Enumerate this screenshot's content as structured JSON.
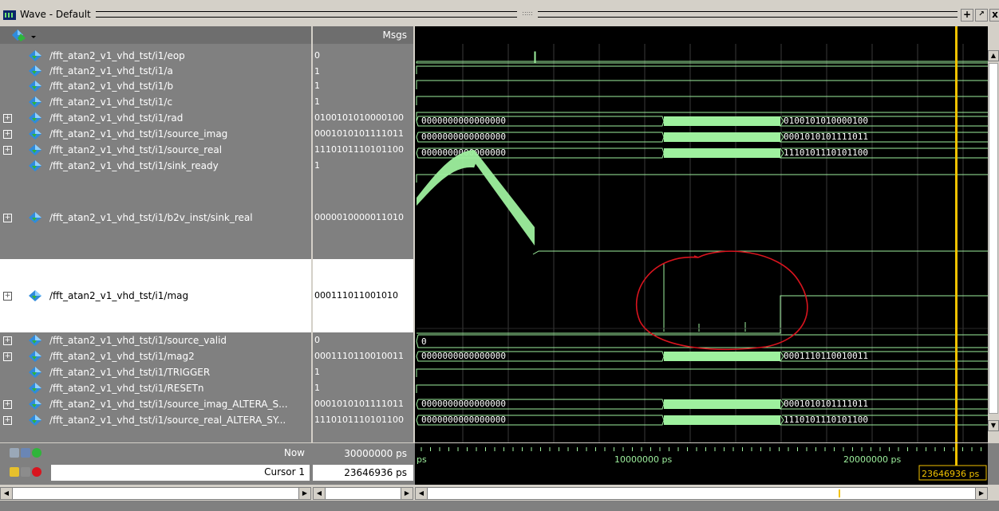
{
  "window": {
    "title": "Wave - Default"
  },
  "columns": {
    "msgs": "Msgs"
  },
  "signals": [
    {
      "name": "/fft_atan2_v1_vhd_tst/i1/eop",
      "value": "0",
      "expandable": false
    },
    {
      "name": "/fft_atan2_v1_vhd_tst/i1/a",
      "value": "1",
      "expandable": false
    },
    {
      "name": "/fft_atan2_v1_vhd_tst/i1/b",
      "value": "1",
      "expandable": false
    },
    {
      "name": "/fft_atan2_v1_vhd_tst/i1/c",
      "value": "1",
      "expandable": false
    },
    {
      "name": "/fft_atan2_v1_vhd_tst/i1/rad",
      "value": "0100101010000100",
      "expandable": true
    },
    {
      "name": "/fft_atan2_v1_vhd_tst/i1/source_imag",
      "value": "0001010101111011",
      "expandable": true
    },
    {
      "name": "/fft_atan2_v1_vhd_tst/i1/source_real",
      "value": "1110101110101100",
      "expandable": true
    },
    {
      "name": "/fft_atan2_v1_vhd_tst/i1/sink_ready",
      "value": "1",
      "expandable": false
    },
    {
      "name": "/fft_atan2_v1_vhd_tst/i1/b2v_inst/sink_real",
      "value": "0000010000011010",
      "expandable": true
    },
    {
      "name": "/fft_atan2_v1_vhd_tst/i1/mag",
      "value": "000111011001010",
      "expandable": true
    },
    {
      "name": "/fft_atan2_v1_vhd_tst/i1/source_valid",
      "value": "0",
      "expandable": true
    },
    {
      "name": "/fft_atan2_v1_vhd_tst/i1/mag2",
      "value": "0001110110010011",
      "expandable": true
    },
    {
      "name": "/fft_atan2_v1_vhd_tst/i1/TRIGGER",
      "value": "1",
      "expandable": false
    },
    {
      "name": "/fft_atan2_v1_vhd_tst/i1/RESETn",
      "value": "1",
      "expandable": false
    },
    {
      "name": "/fft_atan2_v1_vhd_tst/i1/source_imag_ALTERA_S...",
      "value": "0001010101111011",
      "expandable": true
    },
    {
      "name": "/fft_atan2_v1_vhd_tst/i1/source_real_ALTERA_SY...",
      "value": "1110101110101100",
      "expandable": true
    }
  ],
  "bus_labels": {
    "zero": "0000000000000000",
    "rad": "0100101010000100",
    "source_imag": "0001010101111011",
    "source_real": "1110101110101100",
    "source_valid": "0",
    "mag2": "0001110110010011"
  },
  "status": {
    "now_label": "Now",
    "now_value": "30000000 ps",
    "cursor_label": "Cursor 1",
    "cursor_value": "23646936 ps"
  },
  "timeline": {
    "tick_start": "ps",
    "tick_10": "10000000 ps",
    "tick_20": "20000000 ps",
    "cursor_marker": "23646936 ps"
  },
  "colors": {
    "wave": "#9ef09e",
    "cursor": "#f2c200",
    "annotation": "#d8141e",
    "grid": "#3a3a3a"
  }
}
